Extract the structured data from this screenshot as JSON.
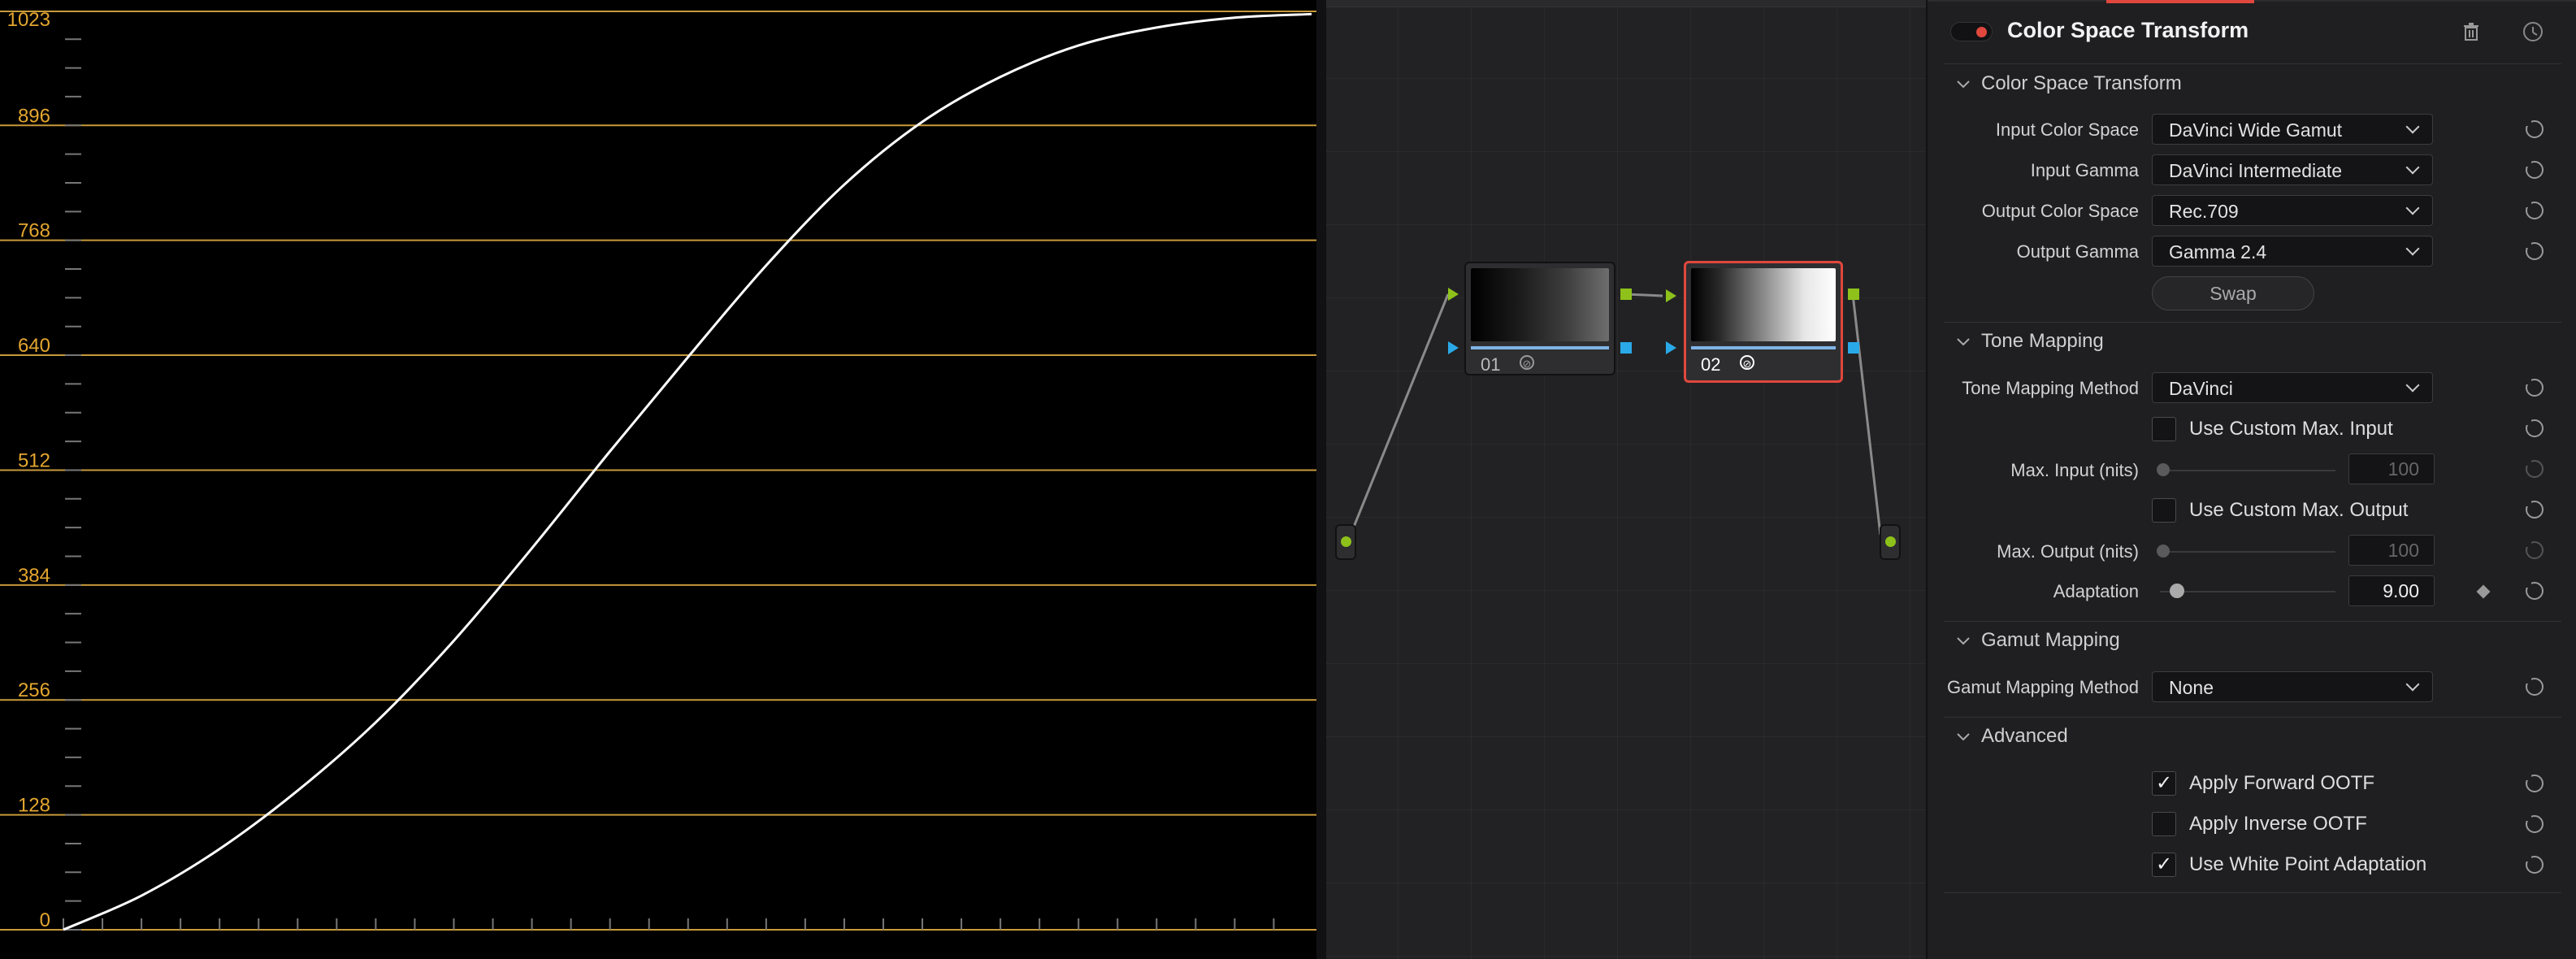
{
  "scope": {
    "y_ticks": [
      "1023",
      "896",
      "768",
      "640",
      "512",
      "384",
      "256",
      "128",
      "0"
    ],
    "colors": {
      "gridline": "#c89a3a",
      "label": "#e3a62f",
      "curve": "#ffffff",
      "background": "#000000"
    }
  },
  "chart_data": {
    "type": "line",
    "ylim": [
      0,
      1023
    ],
    "xlim": [
      0,
      1023
    ],
    "series": [
      {
        "x": [
          0,
          64,
          128,
          192,
          256,
          320,
          384,
          448,
          512,
          576,
          640,
          704,
          768,
          832,
          896,
          960,
          1023
        ],
        "values": [
          0,
          38,
          90,
          155,
          231,
          322,
          425,
          533,
          638,
          740,
          830,
          900,
          950,
          985,
          1005,
          1016,
          1020
        ]
      }
    ]
  },
  "node_editor": {
    "nodes": [
      {
        "id": "01",
        "selected": false
      },
      {
        "id": "02",
        "selected": true
      }
    ],
    "fx_symbol": "⊘",
    "colors": {
      "rgb_port": "#8ec21a",
      "alpha_port": "#2aa9e8",
      "selected_border": "#e0473d"
    }
  },
  "inspector": {
    "title": "Color Space Transform",
    "enabled": true,
    "sections": {
      "cst": "Color Space Transform",
      "tone": "Tone Mapping",
      "gamut": "Gamut Mapping",
      "advanced": "Advanced"
    },
    "labels": {
      "input_color_space": "Input Color Space",
      "input_gamma": "Input Gamma",
      "output_color_space": "Output Color Space",
      "output_gamma": "Output Gamma",
      "tone_mapping_method": "Tone Mapping Method",
      "max_input": "Max. Input (nits)",
      "max_output": "Max. Output (nits)",
      "adaptation": "Adaptation",
      "gamut_mapping_method": "Gamut Mapping Method"
    },
    "values": {
      "input_color_space": "DaVinci Wide Gamut",
      "input_gamma": "DaVinci Intermediate",
      "output_color_space": "Rec.709",
      "output_gamma": "Gamma 2.4",
      "tone_mapping_method": "DaVinci",
      "max_input": "100",
      "max_output": "100",
      "adaptation": "9.00",
      "gamut_mapping_method": "None"
    },
    "swap_label": "Swap",
    "checkboxes": {
      "use_custom_max_input": {
        "label": "Use Custom Max. Input",
        "checked": false
      },
      "use_custom_max_output": {
        "label": "Use Custom Max. Output",
        "checked": false
      },
      "apply_forward_ootf": {
        "label": "Apply Forward OOTF",
        "checked": true
      },
      "apply_inverse_ootf": {
        "label": "Apply Inverse OOTF",
        "checked": false
      },
      "use_white_point_adaptation": {
        "label": "Use White Point Adaptation",
        "checked": true
      }
    },
    "check_mark": "✓",
    "chevron_glyph": "⌵",
    "trash_glyph": "🗑",
    "colors": {
      "accent_red": "#e0473d"
    }
  }
}
